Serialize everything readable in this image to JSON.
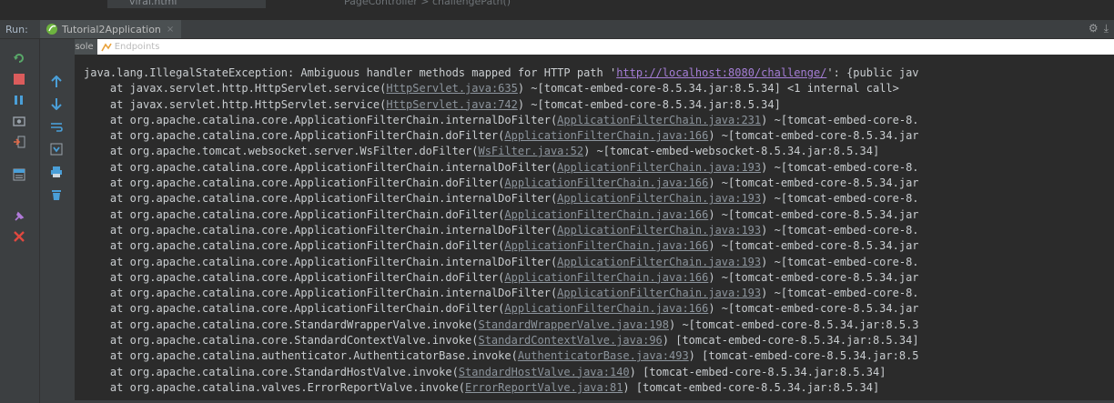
{
  "editor": {
    "file_tab": "viral.html",
    "breadcrumb": "PageController > challengePath()"
  },
  "run_panel": {
    "label": "Run:",
    "tab_name": "Tutorial2Application",
    "close_glyph": "×"
  },
  "header_icons": {
    "settings": "gear-icon",
    "pin": "download-icon"
  },
  "subtabs": {
    "console": "Console",
    "endpoints": "Endpoints"
  },
  "left_tools": [
    "rerun-icon",
    "stop-icon",
    "pause-icon",
    "screenshot-icon",
    "exit-icon",
    "layout-icon",
    "pin-icon",
    "close-icon"
  ],
  "left_tools2": [
    "up-arrow-icon",
    "down-arrow-icon",
    "wrap-icon",
    "scroll-to-end-icon",
    "print-icon",
    "trash-icon"
  ],
  "colors": {
    "console_bg": "#2b2b2b",
    "toolbar_bg": "#3c3f41",
    "text": "#c9cdd0",
    "link": "#a57ed6",
    "src_link": "#8c949c"
  },
  "console": {
    "lines": [
      {
        "pre": "java.lang.IllegalStateException: Ambiguous handler methods mapped for HTTP path '",
        "link": "http://localhost:8080/challenge/",
        "post": "': {public jav"
      },
      {
        "pre": "    at javax.servlet.http.HttpServlet.service(",
        "link": "HttpServlet.java:635",
        "post": ") ~[tomcat-embed-core-8.5.34.jar:8.5.34] <1 internal call>"
      },
      {
        "pre": "    at javax.servlet.http.HttpServlet.service(",
        "link": "HttpServlet.java:742",
        "post": ") ~[tomcat-embed-core-8.5.34.jar:8.5.34]"
      },
      {
        "pre": "    at org.apache.catalina.core.ApplicationFilterChain.internalDoFilter(",
        "link": "ApplicationFilterChain.java:231",
        "post": ") ~[tomcat-embed-core-8."
      },
      {
        "pre": "    at org.apache.catalina.core.ApplicationFilterChain.doFilter(",
        "link": "ApplicationFilterChain.java:166",
        "post": ") ~[tomcat-embed-core-8.5.34.jar"
      },
      {
        "pre": "    at org.apache.tomcat.websocket.server.WsFilter.doFilter(",
        "link": "WsFilter.java:52",
        "post": ") ~[tomcat-embed-websocket-8.5.34.jar:8.5.34]"
      },
      {
        "pre": "    at org.apache.catalina.core.ApplicationFilterChain.internalDoFilter(",
        "link": "ApplicationFilterChain.java:193",
        "post": ") ~[tomcat-embed-core-8."
      },
      {
        "pre": "    at org.apache.catalina.core.ApplicationFilterChain.doFilter(",
        "link": "ApplicationFilterChain.java:166",
        "post": ") ~[tomcat-embed-core-8.5.34.jar"
      },
      {
        "pre": "    at org.apache.catalina.core.ApplicationFilterChain.internalDoFilter(",
        "link": "ApplicationFilterChain.java:193",
        "post": ") ~[tomcat-embed-core-8."
      },
      {
        "pre": "    at org.apache.catalina.core.ApplicationFilterChain.doFilter(",
        "link": "ApplicationFilterChain.java:166",
        "post": ") ~[tomcat-embed-core-8.5.34.jar"
      },
      {
        "pre": "    at org.apache.catalina.core.ApplicationFilterChain.internalDoFilter(",
        "link": "ApplicationFilterChain.java:193",
        "post": ") ~[tomcat-embed-core-8."
      },
      {
        "pre": "    at org.apache.catalina.core.ApplicationFilterChain.doFilter(",
        "link": "ApplicationFilterChain.java:166",
        "post": ") ~[tomcat-embed-core-8.5.34.jar"
      },
      {
        "pre": "    at org.apache.catalina.core.ApplicationFilterChain.internalDoFilter(",
        "link": "ApplicationFilterChain.java:193",
        "post": ") ~[tomcat-embed-core-8."
      },
      {
        "pre": "    at org.apache.catalina.core.ApplicationFilterChain.doFilter(",
        "link": "ApplicationFilterChain.java:166",
        "post": ") ~[tomcat-embed-core-8.5.34.jar"
      },
      {
        "pre": "    at org.apache.catalina.core.ApplicationFilterChain.internalDoFilter(",
        "link": "ApplicationFilterChain.java:193",
        "post": ") ~[tomcat-embed-core-8."
      },
      {
        "pre": "    at org.apache.catalina.core.ApplicationFilterChain.doFilter(",
        "link": "ApplicationFilterChain.java:166",
        "post": ") ~[tomcat-embed-core-8.5.34.jar"
      },
      {
        "pre": "    at org.apache.catalina.core.StandardWrapperValve.invoke(",
        "link": "StandardWrapperValve.java:198",
        "post": ") ~[tomcat-embed-core-8.5.34.jar:8.5.3"
      },
      {
        "pre": "    at org.apache.catalina.core.StandardContextValve.invoke(",
        "link": "StandardContextValve.java:96",
        "post": ") [tomcat-embed-core-8.5.34.jar:8.5.34]"
      },
      {
        "pre": "    at org.apache.catalina.authenticator.AuthenticatorBase.invoke(",
        "link": "AuthenticatorBase.java:493",
        "post": ") [tomcat-embed-core-8.5.34.jar:8.5"
      },
      {
        "pre": "    at org.apache.catalina.core.StandardHostValve.invoke(",
        "link": "StandardHostValve.java:140",
        "post": ") [tomcat-embed-core-8.5.34.jar:8.5.34]"
      },
      {
        "pre": "    at org.apache.catalina.valves.ErrorReportValve.invoke(",
        "link": "ErrorReportValve.java:81",
        "post": ") [tomcat-embed-core-8.5.34.jar:8.5.34]"
      }
    ]
  }
}
